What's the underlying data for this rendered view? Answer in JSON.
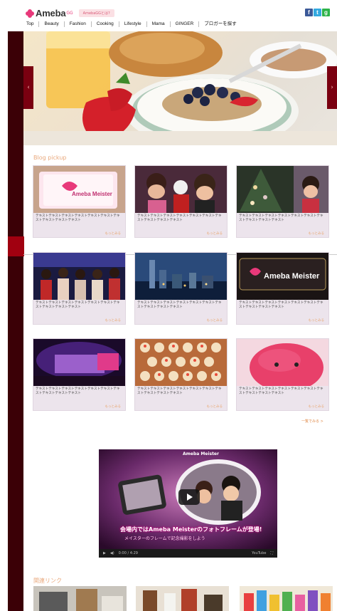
{
  "header": {
    "logo_text": "Ameba",
    "logo_sup": "GG",
    "badge": "AmebaGGとは?",
    "social": [
      "f",
      "t",
      "g"
    ],
    "nav": [
      "Top",
      "Beauty",
      "Fashion",
      "Cooking",
      "Lifestyle",
      "Mama",
      "GINGER",
      "ブロガーを探す"
    ]
  },
  "hero": {
    "prev_icon": "chevron-left-icon",
    "next_icon": "chevron-right-icon",
    "prev_glyph": "‹",
    "next_glyph": "›"
  },
  "sections": {
    "blog_pickup": "Blog pickup",
    "related": "関連リンク",
    "list_all": "一覧でみる >"
  },
  "cards": [
    {
      "text": "テキストテキストテキストテキストテキストテキストテキストテキストテキストテキスト",
      "more": "もっとみる"
    },
    {
      "text": "テキストテキストテキストテキストテキストテキストテキストテキストテキストテキスト",
      "more": "もっとみる"
    },
    {
      "text": "テキストテキストテキストテキストテキストテキストテキストテキストテキストテキスト",
      "more": "もっとみる"
    },
    {
      "text": "テキストテキストテキストテキストテキストテキストテキストテキストテキストテキスト",
      "more": "もっとみる"
    },
    {
      "text": "テキストテキストテキストテキストテキストテキストテキストテキストテキストテキスト",
      "more": "もっとみる"
    },
    {
      "text": "テキストテキストテキストテキストテキストテキストテキストテキストテキストテキスト",
      "more": "もっとみる"
    },
    {
      "text": "テキストテキストテキストテキストテキストテキストテキストテキストテキストテキスト",
      "more": "もっとみる"
    },
    {
      "text": "テキストテキストテキストテキストテキストテキストテキストテキストテキストテキスト",
      "more": "もっとみる"
    },
    {
      "text": "テキストテキストテキストテキストテキストテキストテキストテキストテキストテキスト",
      "more": "もっとみる"
    }
  ],
  "thumb_labels": {
    "cake": "Ameba Meister",
    "meister_banner": "Ameba Meister"
  },
  "video": {
    "brand": "Ameba Meister",
    "caption": "会場内ではAmeba Meisterのフォトフレームが登場!",
    "caption2": "メイスターのフレームで記念撮影をしよう",
    "time": "0:00 / 4:29",
    "play_glyph": "▶",
    "volume_glyph": "◀)",
    "yt": "YouTube",
    "fullscreen_glyph": "⛶"
  },
  "colors": {
    "accent": "#e9a87c",
    "sidebar": "#3b0006",
    "arrow": "#7a0010"
  }
}
